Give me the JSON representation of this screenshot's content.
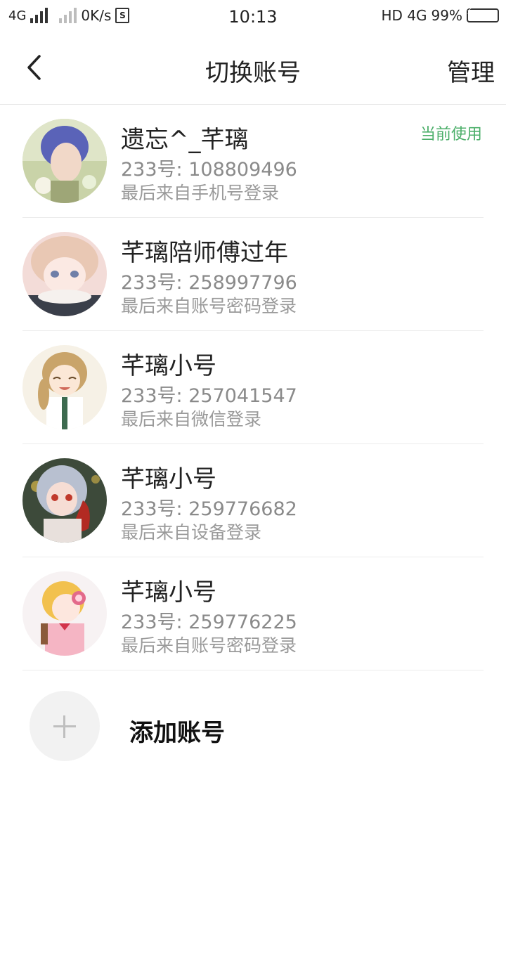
{
  "status_bar": {
    "network_type": "4G",
    "speed": "0K/s",
    "sim_label": "S",
    "time": "10:13",
    "right_network": "HD 4G",
    "battery_percent": "99%",
    "battery_level": 0.99
  },
  "header": {
    "title": "切换账号",
    "manage_label": "管理"
  },
  "accounts": [
    {
      "name": "遗忘^_芊璃",
      "id_line": "233号: 108809496",
      "source": "最后来自手机号登录",
      "current_label": "当前使用"
    },
    {
      "name": "芊璃陪师傅过年",
      "id_line": "233号: 258997796",
      "source": "最后来自账号密码登录"
    },
    {
      "name": "芊璃小号",
      "id_line": "233号: 257041547",
      "source": "最后来自微信登录"
    },
    {
      "name": "芊璃小号",
      "id_line": "233号: 259776682",
      "source": "最后来自设备登录"
    },
    {
      "name": "芊璃小号",
      "id_line": "233号: 259776225",
      "source": "最后来自账号密码登录"
    }
  ],
  "add_account": {
    "label": "添加账号",
    "icon": "plus-icon"
  },
  "colors": {
    "current_tag": "#4caf6a",
    "secondary_text": "#8a8a8a",
    "divider": "#ececec"
  }
}
